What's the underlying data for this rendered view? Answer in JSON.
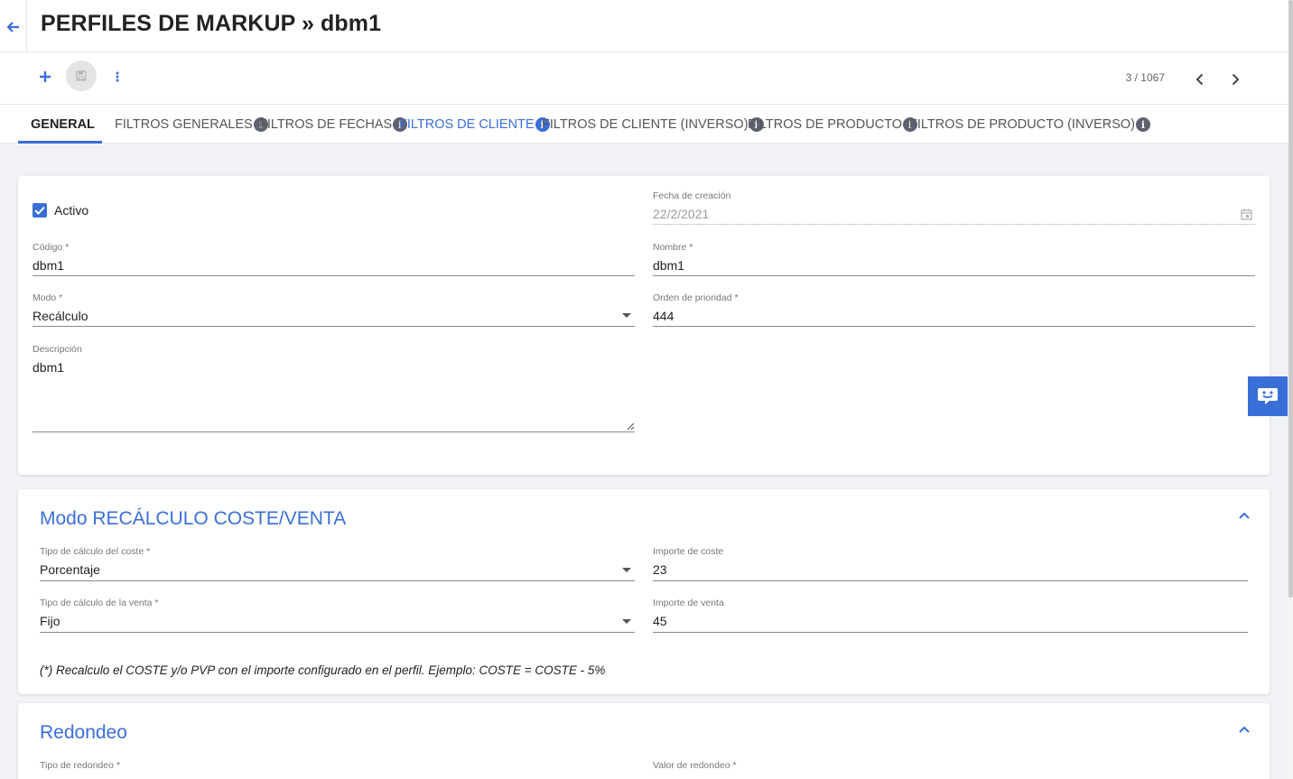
{
  "header": {
    "title": "PERFILES DE MARKUP » dbm1"
  },
  "toolbar": {
    "pager_text": "3 / 1067"
  },
  "tabs": [
    {
      "label": "GENERAL"
    },
    {
      "label": "FILTROS GENERALES"
    },
    {
      "label": "FILTROS DE FECHAS"
    },
    {
      "label": "FILTROS DE CLIENTE"
    },
    {
      "label": "FILTROS DE CLIENTE (INVERSO)"
    },
    {
      "label": "FILTROS DE PRODUCTO"
    },
    {
      "label": "FILTROS DE PRODUCTO (INVERSO)"
    }
  ],
  "info_glyph": "i",
  "general": {
    "activo_label": "Activo",
    "activo_checked": true,
    "fecha_creacion": {
      "label": "Fecha de creación",
      "value": "22/2/2021"
    },
    "codigo": {
      "label": "Código *",
      "value": "dbm1"
    },
    "nombre": {
      "label": "Nombre *",
      "value": "dbm1"
    },
    "modo": {
      "label": "Modo *",
      "value": "Recálculo"
    },
    "orden": {
      "label": "Orden de prioridad *",
      "value": "444"
    },
    "descripcion": {
      "label": "Descripción",
      "value": "dbm1"
    }
  },
  "recalculo": {
    "title": "Modo RECÁLCULO COSTE/VENTA",
    "tipo_coste": {
      "label": "Tipo de cálculo del coste *",
      "value": "Porcentaje"
    },
    "importe_coste": {
      "label": "Importe de coste",
      "value": "23"
    },
    "tipo_venta": {
      "label": "Tipo de cálculo de la venta *",
      "value": "Fijo"
    },
    "importe_venta": {
      "label": "Importe de venta",
      "value": "45"
    },
    "note": "(*) Recalculo el COSTE y/o PVP con el importe configurado en el perfil. Ejemplo: COSTE = COSTE - 5%"
  },
  "redondeo": {
    "title": "Redondeo",
    "tipo": {
      "label": "Tipo de redondeo *"
    },
    "valor": {
      "label": "Valor de redondeo *"
    }
  },
  "colors": {
    "accent": "#3a6fd8",
    "info_icon": "#5e6170"
  }
}
